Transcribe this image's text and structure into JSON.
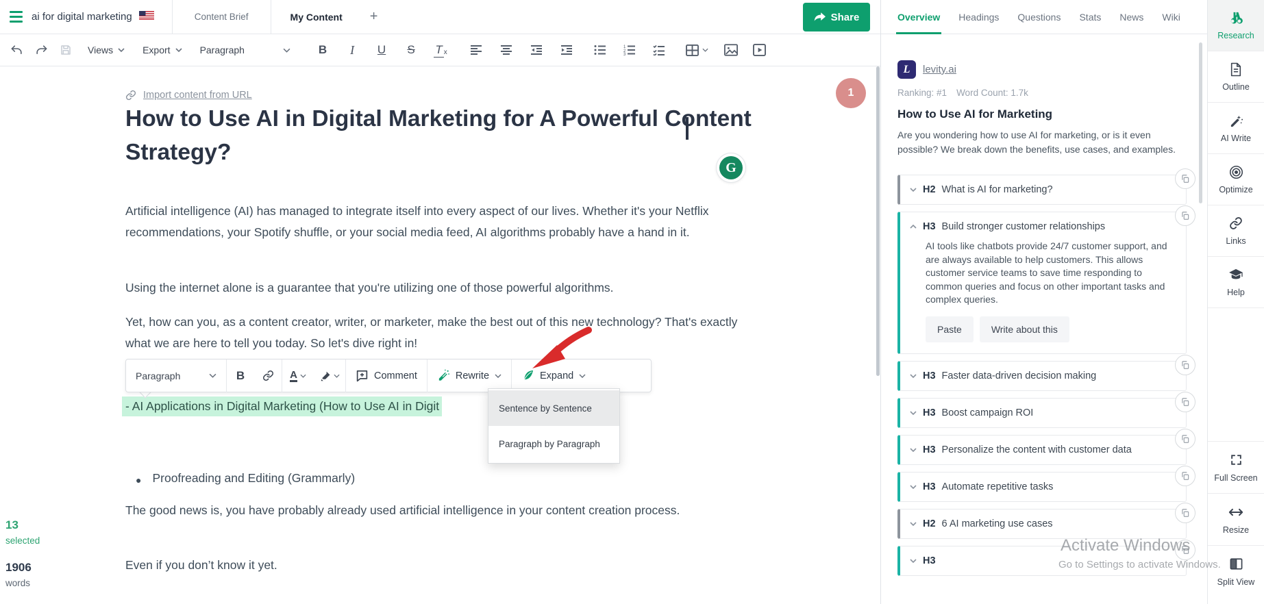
{
  "topbar": {
    "query": "ai for digital marketing",
    "tabs": [
      {
        "label": "Content Brief"
      },
      {
        "label": "My Content"
      }
    ],
    "add_tab": "+",
    "share_label": "Share"
  },
  "toolbar": {
    "views_label": "Views",
    "export_label": "Export",
    "paragraph_label": "Paragraph"
  },
  "editor": {
    "import_link": "Import content from URL",
    "title": "How to Use AI in Digital Marketing for A Powerful Content Strategy?",
    "badge": "1",
    "grammarly_letter": "G",
    "p1": "Artificial intelligence (AI) has managed to integrate itself into every aspect of our lives. Whether it's your Netflix recommendations, your Spotify shuffle, or your social media feed, AI algorithms probably have a hand in it.",
    "p2": "Using the internet alone is a guarantee that you're utilizing one of those powerful algorithms.",
    "p3": "Yet, how can you, as a content creator, writer, or marketer, make the best out of this new technology? That's exactly what we are here to tell you today. So let's dive right in!",
    "highlighted_text": "- AI Applications in Digital Marketing (How to Use AI in Digit",
    "bullet1": "Proofreading and Editing (Grammarly)",
    "p4": "The good news is, you have probably already used artificial intelligence in your content creation process.",
    "p5": "Even if you don’t know it yet."
  },
  "selection_toolbar": {
    "paragraph_label": "Paragraph",
    "comment_label": "Comment",
    "rewrite_label": "Rewrite",
    "expand_label": "Expand",
    "rewrite_menu": [
      "Sentence by Sentence",
      "Paragraph by Paragraph"
    ]
  },
  "status": {
    "selected_value": "13",
    "selected_label": "selected",
    "words_value": "1906",
    "words_label": "words"
  },
  "research_panel": {
    "tabs": [
      "Overview",
      "Headings",
      "Questions",
      "Stats",
      "News",
      "Wiki"
    ],
    "active_tab": "Overview",
    "source": {
      "name": "levity.ai",
      "icon_letter": "L",
      "ranking": "Ranking: #1",
      "word_count": "Word Count: 1.7k"
    },
    "article": {
      "title": "How to Use AI for Marketing",
      "description": "Are you wondering how to use AI for marketing, or is it even possible? We break down the benefits, use cases, and examples."
    },
    "headings": [
      {
        "tag": "H2",
        "text": "What is AI for marketing?",
        "expanded": false
      },
      {
        "tag": "H3",
        "text": "Build stronger customer relationships",
        "expanded": true,
        "body": "AI tools like chatbots provide 24/7 customer support, and are always available to help customers. This allows customer service teams to save time responding to common queries and focus on other important tasks and complex queries.",
        "buttons": [
          "Paste",
          "Write about this"
        ]
      },
      {
        "tag": "H3",
        "text": "Faster data-driven decision making",
        "expanded": false
      },
      {
        "tag": "H3",
        "text": "Boost campaign ROI",
        "expanded": false
      },
      {
        "tag": "H3",
        "text": "Personalize the content with customer data",
        "expanded": false
      },
      {
        "tag": "H3",
        "text": "Automate repetitive tasks",
        "expanded": false
      },
      {
        "tag": "H2",
        "text": "6 AI marketing use cases",
        "expanded": false
      },
      {
        "tag": "H3",
        "text": "",
        "expanded": false,
        "partial": true
      }
    ]
  },
  "rail": {
    "items": [
      {
        "label": "Research",
        "icon": "binoculars-icon",
        "active": true
      },
      {
        "label": "Outline",
        "icon": "document-icon",
        "active": false
      },
      {
        "label": "AI Write",
        "icon": "wand-icon",
        "active": false
      },
      {
        "label": "Optimize",
        "icon": "target-icon",
        "active": false
      },
      {
        "label": "Links",
        "icon": "link-icon",
        "active": false
      },
      {
        "label": "Help",
        "icon": "graduation-cap-icon",
        "active": false
      }
    ],
    "bottom_items": [
      {
        "label": "Full Screen",
        "icon": "fullscreen-icon"
      },
      {
        "label": "Resize",
        "icon": "resize-icon"
      },
      {
        "label": "Split View",
        "icon": "split-view-icon"
      }
    ]
  },
  "watermark": {
    "line1": "Activate Windows",
    "line2": "Go to Settings to activate Windows."
  },
  "colors": {
    "accent_green": "#0e9f6e",
    "teal_card_border": "#1ab3a5",
    "gray_card_border": "#8d949c",
    "badge_pink": "#d98e8c",
    "highlight_mint": "#c7f3dc"
  }
}
